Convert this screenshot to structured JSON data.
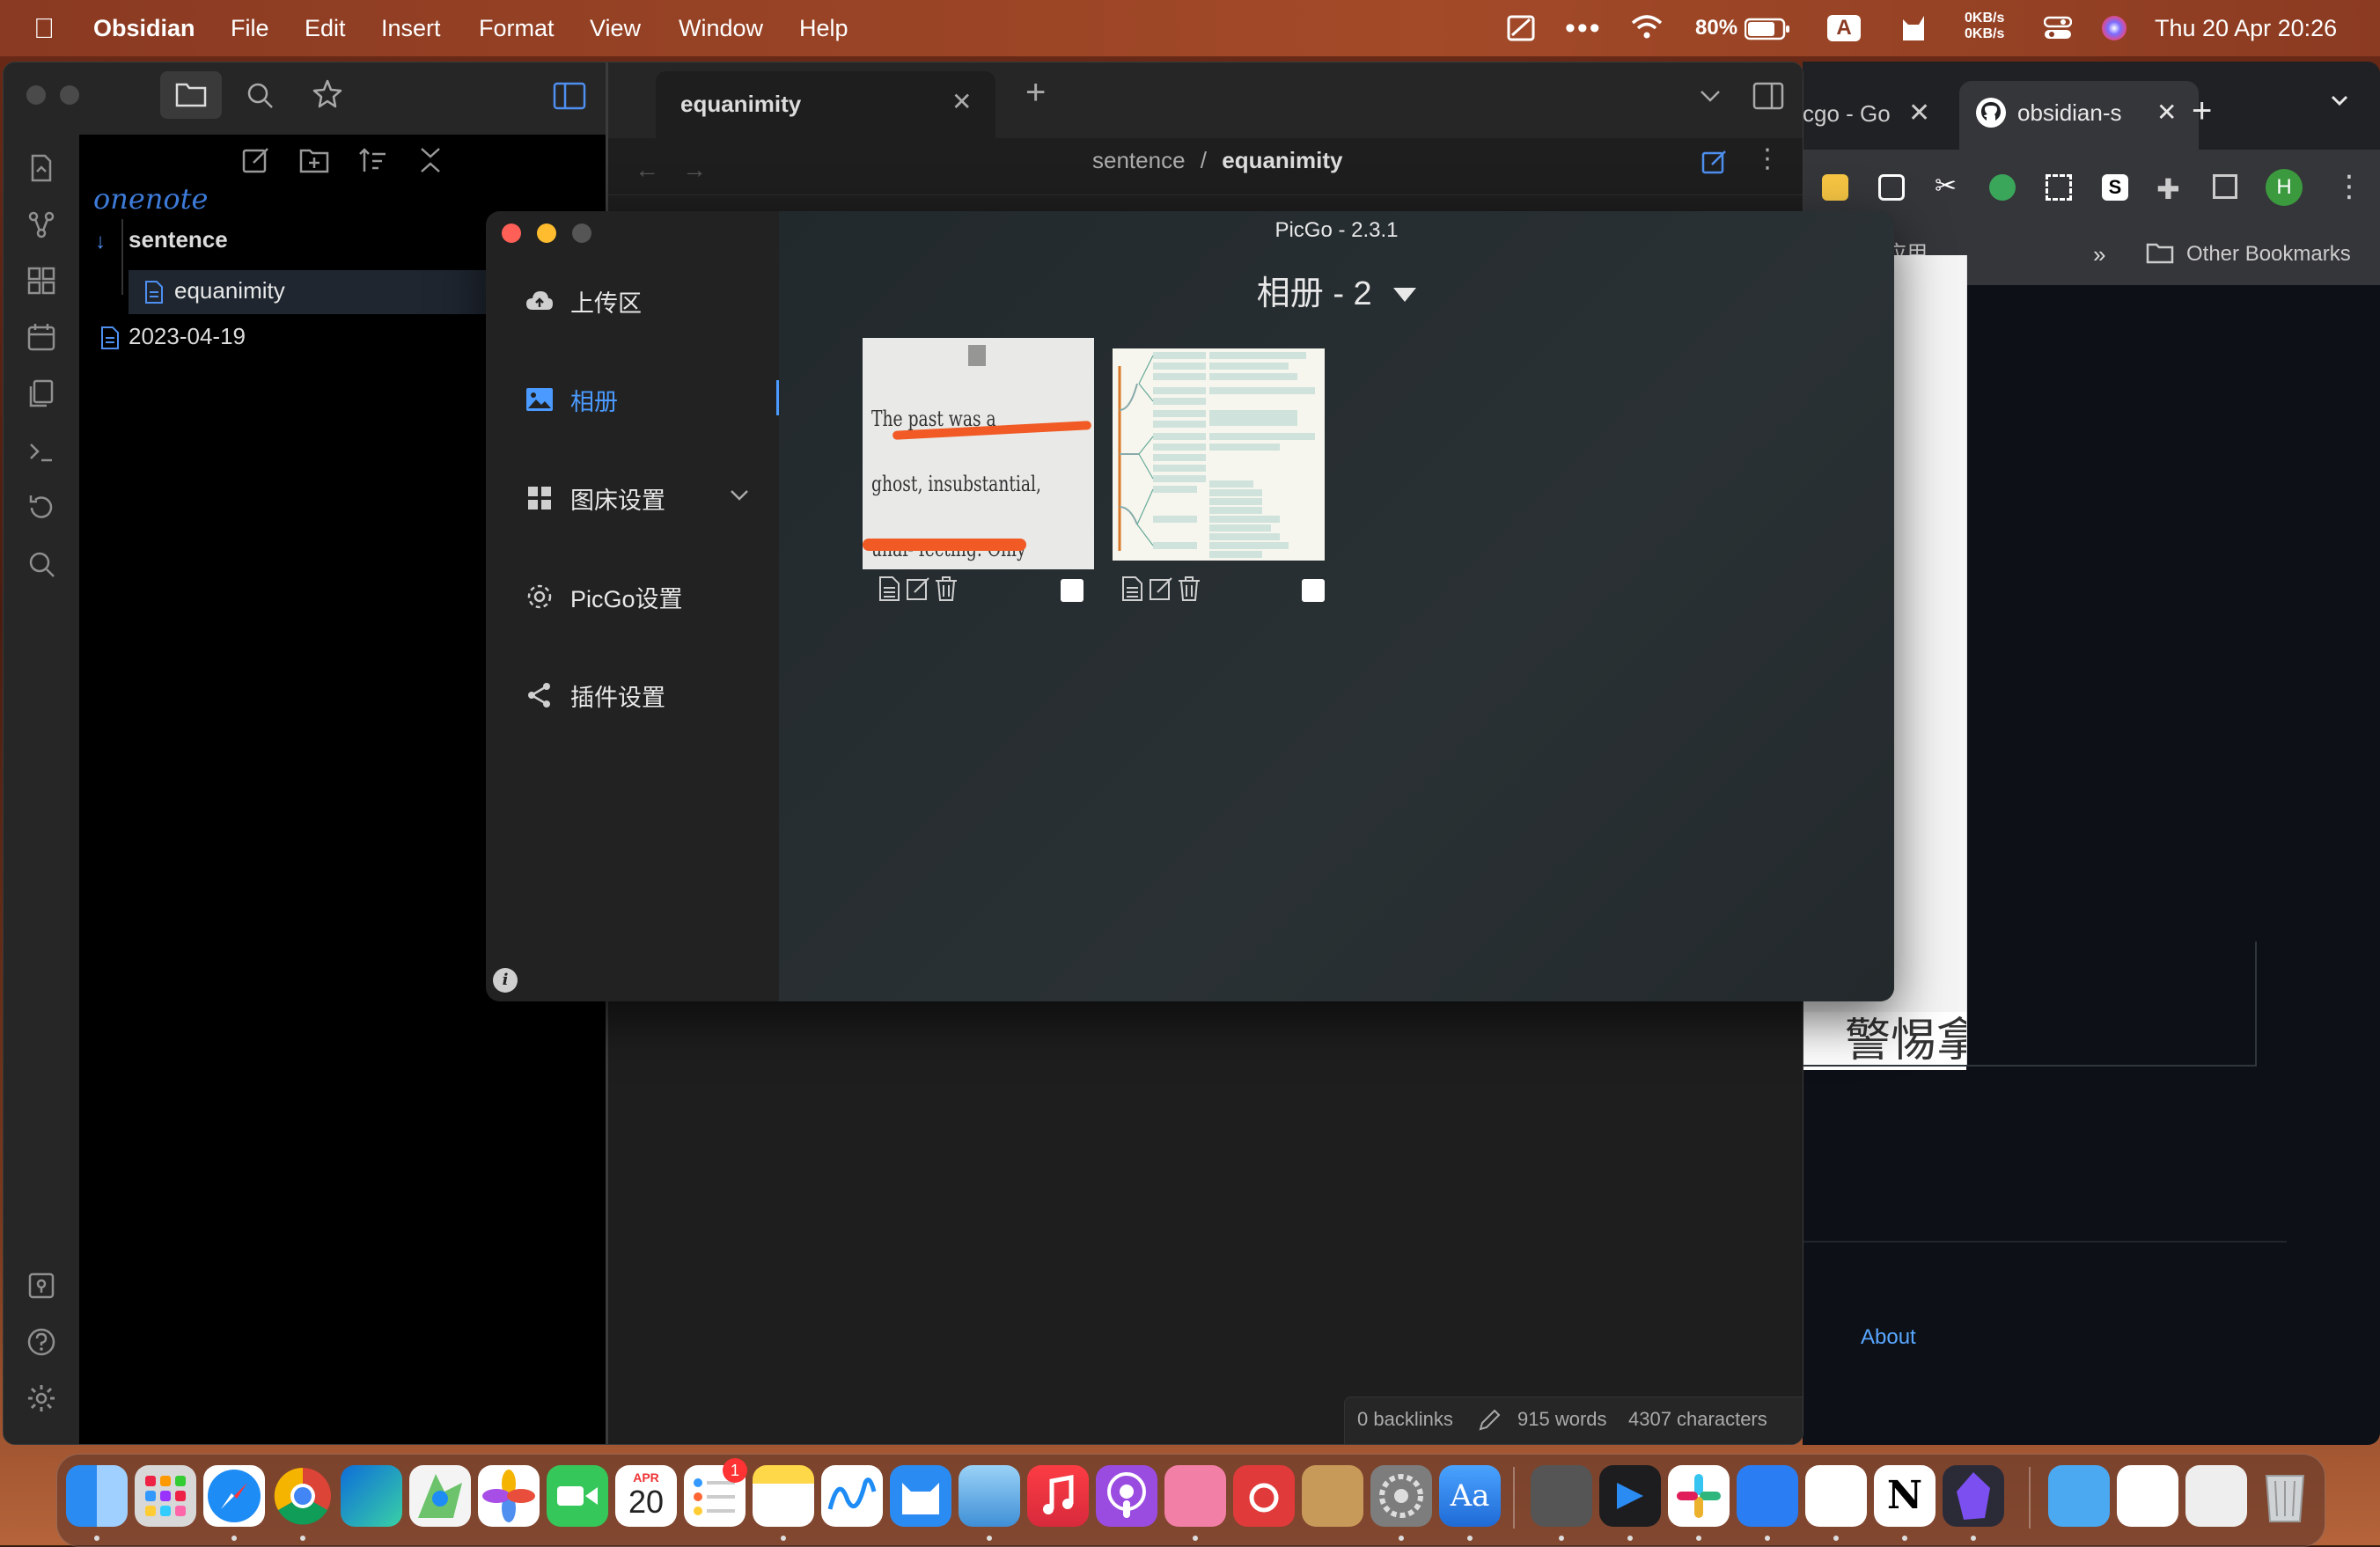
{
  "menubar": {
    "app": "Obsidian",
    "menus": [
      "File",
      "Edit",
      "Insert",
      "Format",
      "View",
      "Window",
      "Help"
    ],
    "net_up": "0KB/s",
    "net_down": "0KB/s",
    "battery": "80%",
    "input_source": "A",
    "datetime": "Thu 20 Apr  20:26"
  },
  "obsidian": {
    "vault": "onenote",
    "folder": "sentence",
    "file_active": "equanimity",
    "file_other": "2023-04-19",
    "tab_title": "equanimity",
    "breadcrumb_parent": "sentence",
    "breadcrumb_sep": "/",
    "breadcrumb_current": "equanimity",
    "status": {
      "backlinks": "0 backlinks",
      "words": "915 words",
      "chars": "4307 characters"
    }
  },
  "chrome": {
    "tab1": "cgo - Go",
    "tab2": "obsidian-s",
    "bookmark_partial": "应用...",
    "bookmarks_more": "»",
    "other_bookmarks": "Other Bookmarks",
    "profile_initial": "H",
    "page_fragment": "警惕拿",
    "footer_link": "About"
  },
  "picgo": {
    "title": "PicGo - 2.3.1",
    "nav": {
      "upload": "上传区",
      "album": "相册",
      "bed_settings": "图床设置",
      "picgo_settings": "PicGo设置",
      "plugin_settings": "插件设置"
    },
    "album_header": "相册 - 2",
    "image1_text": "The past was a ghost, insubstantial, unaf- fecting. Only the future had weight."
  },
  "dock": {
    "calendar_month": "APR",
    "calendar_day": "20",
    "reminders_badge": "1"
  }
}
